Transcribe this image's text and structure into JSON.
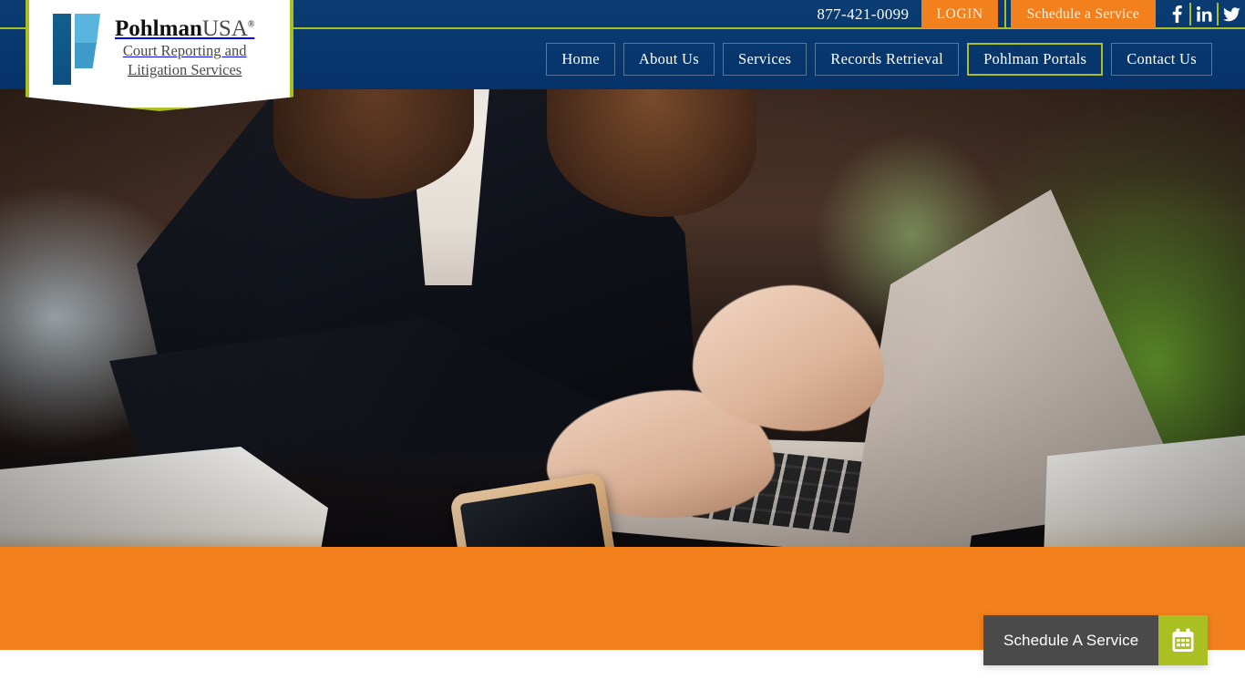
{
  "site": {
    "brand_name": "PohlmanUSA",
    "brand_suffix": "USA",
    "brand_primary": "Pohlman",
    "brand_registered": "®",
    "tagline_line1": "Court Reporting and",
    "tagline_line2": "Litigation Services"
  },
  "colors": {
    "navy": "#06386b",
    "orange": "#f2811d",
    "lime": "#a9bf22",
    "cta_gray": "#4a4a4a",
    "white": "#ffffff"
  },
  "topbar": {
    "phone": "877-421-0099",
    "login_label": "LOGIN",
    "schedule_label": "Schedule a Service",
    "social": [
      {
        "name": "facebook",
        "icon": "facebook-icon",
        "label": "f"
      },
      {
        "name": "linkedin",
        "icon": "linkedin-icon",
        "label": "in"
      },
      {
        "name": "twitter",
        "icon": "twitter-icon",
        "label": "twitter"
      }
    ]
  },
  "nav": {
    "items": [
      {
        "label": "Home",
        "active": false
      },
      {
        "label": "About Us",
        "active": false
      },
      {
        "label": "Services",
        "active": false
      },
      {
        "label": "Records Retrieval",
        "active": false
      },
      {
        "label": "Pohlman Portals",
        "active": true
      },
      {
        "label": "Contact Us",
        "active": false
      }
    ]
  },
  "hero": {
    "description": "Businesswoman in dark blazer typing on a laptop at a desk with books and a smartphone"
  },
  "cta": {
    "schedule_label": "Schedule A Service",
    "icon": "calendar-icon"
  }
}
